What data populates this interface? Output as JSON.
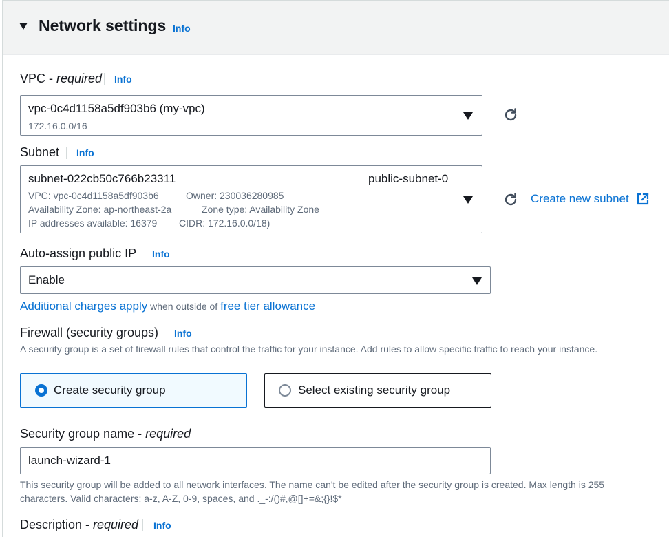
{
  "section": {
    "title": "Network settings",
    "info": "Info"
  },
  "vpc": {
    "label": "VPC - ",
    "required": "required",
    "info": "Info",
    "value": "vpc-0c4d1158a5df903b6 (my-vpc)",
    "cidr": "172.16.0.0/16"
  },
  "subnet": {
    "label": "Subnet",
    "info": "Info",
    "id": "subnet-022cb50c766b23311",
    "name": "public-subnet-0",
    "line1a": "VPC: vpc-0c4d1158a5df903b6",
    "line1b": "Owner: 230036280985",
    "line2a": "Availability Zone: ap-northeast-2a",
    "line2b": "Zone type: Availability Zone",
    "line3a": "IP addresses available: 16379",
    "line3b": "CIDR: 172.16.0.0/18)",
    "create_link": "Create new subnet"
  },
  "public_ip": {
    "label": "Auto-assign public IP",
    "info": "Info",
    "value": "Enable",
    "charges_link": "Additional charges apply",
    "charges_text": " when outside of ",
    "tier_link": "free tier allowance"
  },
  "firewall": {
    "label": "Firewall (security groups)",
    "info": "Info",
    "description": "A security group is a set of firewall rules that control the traffic for your instance. Add rules to allow specific traffic to reach your instance.",
    "option_create": "Create security group",
    "option_existing": "Select existing security group",
    "selected": "create"
  },
  "sg_name": {
    "label": "Security group name - ",
    "required": "required",
    "value": "launch-wizard-1",
    "help": "This security group will be added to all network interfaces. The name can't be edited after the security group is created. Max length is 255 characters. Valid characters: a-z, A-Z, 0-9, spaces, and ._-:/()#,@[]+=&;{}!$*"
  },
  "description": {
    "label": "Description - ",
    "required": "required",
    "info": "Info"
  },
  "colors": {
    "accent": "#0972d3",
    "text": "#16191f",
    "muted": "#5f6b7a",
    "border": "#7d8998",
    "header_bg": "#f2f3f3"
  }
}
